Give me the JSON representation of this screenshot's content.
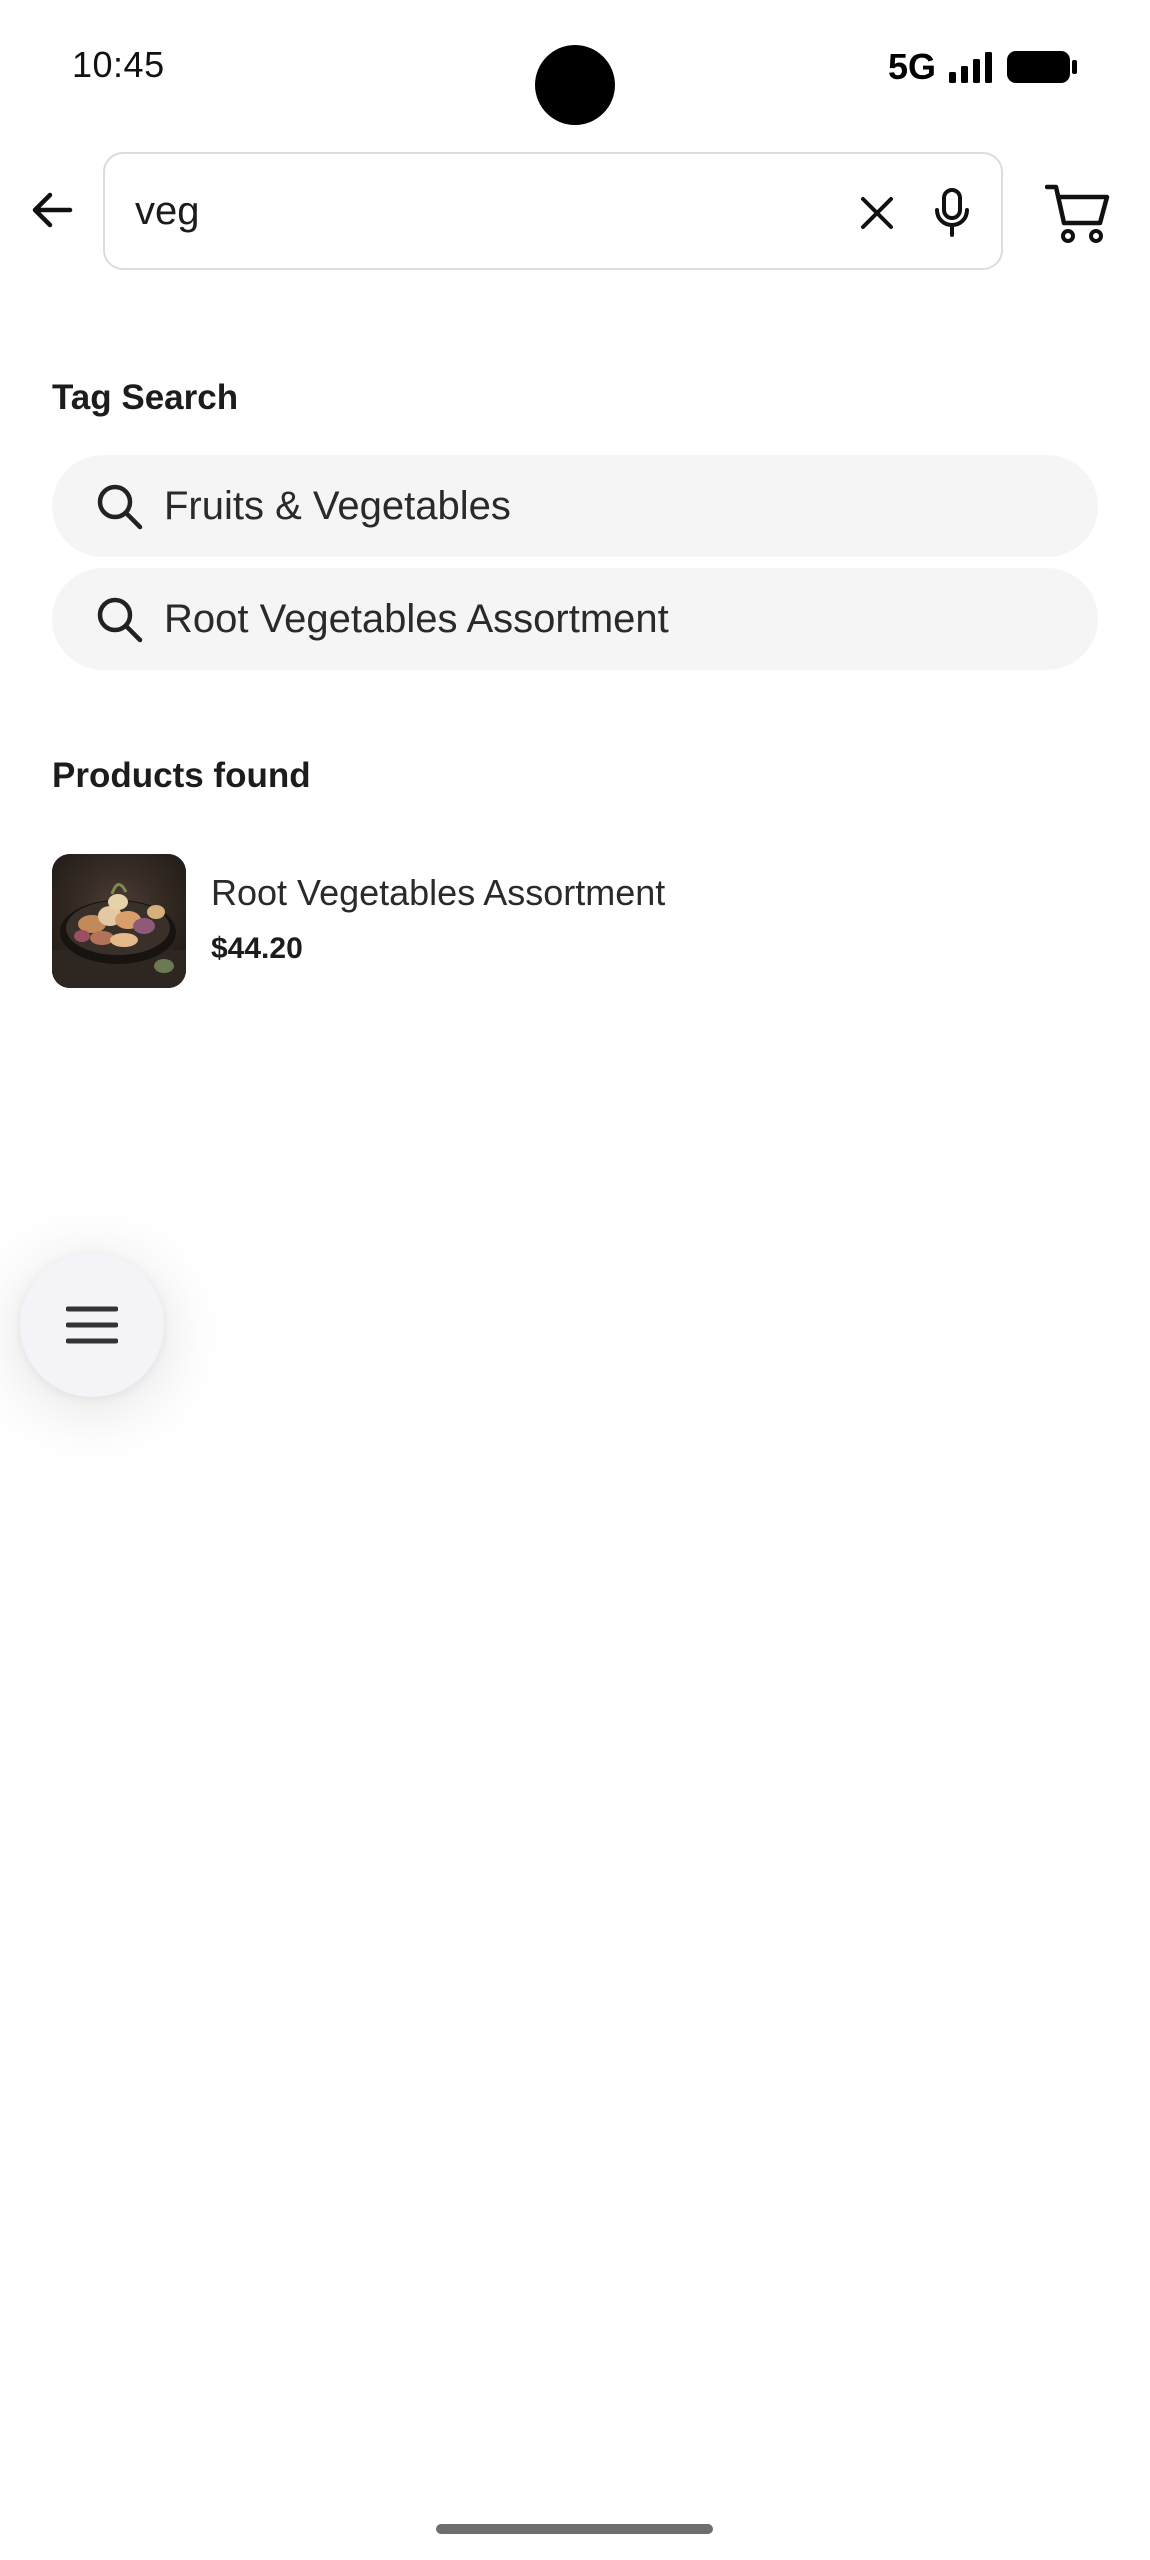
{
  "status_bar": {
    "time": "10:45",
    "network": "5G"
  },
  "search": {
    "query": "veg"
  },
  "tag_search": {
    "heading": "Tag Search",
    "tags": [
      {
        "label": "Fruits & Vegetables"
      },
      {
        "label": "Root Vegetables Assortment"
      }
    ]
  },
  "products": {
    "heading": "Products found",
    "items": [
      {
        "name": "Root Vegetables Assortment",
        "price": "$44.20"
      }
    ]
  },
  "icons": {
    "back": "arrow-left-icon",
    "clear": "close-icon",
    "mic": "microphone-icon",
    "cart": "shopping-cart-icon",
    "tag": "search-icon",
    "menu": "hamburger-menu-icon"
  },
  "colors": {
    "chip_background": "#f5f5f5",
    "fab_background": "#f4f3f8",
    "text_primary": "#1c1c1e"
  }
}
